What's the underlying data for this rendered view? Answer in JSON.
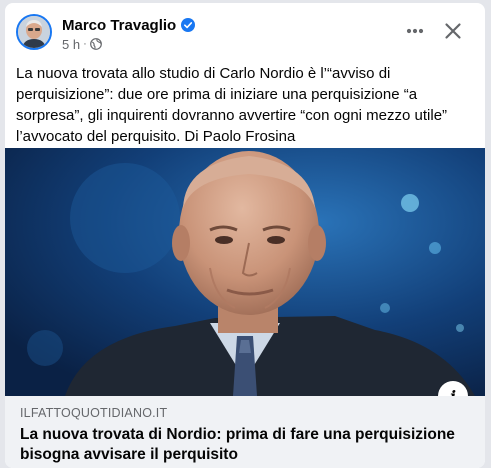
{
  "post": {
    "author": "Marco Travaglio",
    "verified": true,
    "time": "5 h",
    "separator": "·",
    "privacy_icon": "globe-icon",
    "more_icon": "more-horizontal-icon",
    "close_icon": "close-icon",
    "text": "La nuova trovata allo studio di Carlo Nordio è l’“avviso di perquisizione”: due ore prima di iniziare una perquisizione “a sorpresa”, gli inquirenti dovranno avvertire “con ogni mezzo utile” l’avvocato del perquisito. Di Paolo Frosina"
  },
  "link_preview": {
    "domain": "ILFATTOQUOTIDIANO.IT",
    "title": "La nuova trovata di Nordio: prima di fare una perquisizione bisogna avvisare il perquisito",
    "info_icon": "info-icon"
  },
  "colors": {
    "verified_blue": "#1877f2",
    "meta_gray": "#65676b",
    "link_footer_bg": "#f0f2f5"
  }
}
